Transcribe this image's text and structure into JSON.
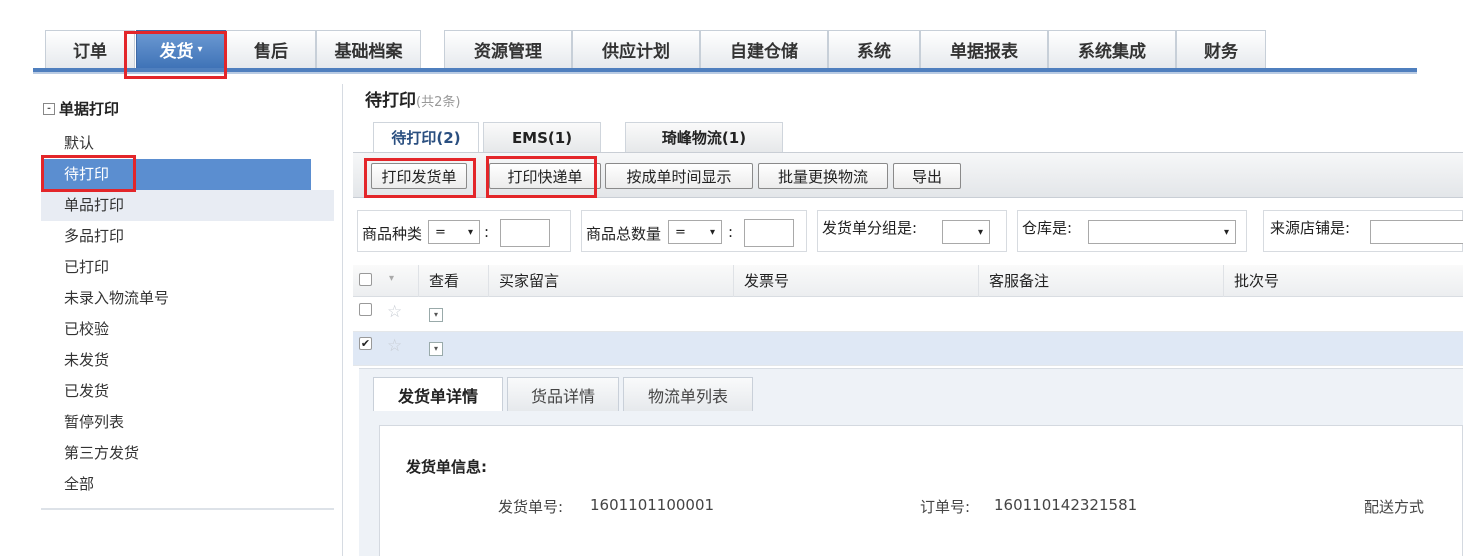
{
  "topnav": {
    "tabs": [
      {
        "label": "订单"
      },
      {
        "label": "发货",
        "caret": "▾"
      },
      {
        "label": "售后"
      },
      {
        "label": "基础档案"
      },
      {
        "label": "资源管理"
      },
      {
        "label": "供应计划"
      },
      {
        "label": "自建仓储"
      },
      {
        "label": "系统"
      },
      {
        "label": "单据报表"
      },
      {
        "label": "系统集成"
      },
      {
        "label": "财务"
      }
    ],
    "active_index": 1,
    "accent_color": "#4f7fbe"
  },
  "sidebar": {
    "section_toggle": "-",
    "section_title": "单据打印",
    "items": [
      {
        "label": "默认"
      },
      {
        "label": "待打印"
      },
      {
        "label": "单品打印"
      },
      {
        "label": "多品打印"
      },
      {
        "label": "已打印"
      },
      {
        "label": "未录入物流单号"
      },
      {
        "label": "已校验"
      },
      {
        "label": "未发货"
      },
      {
        "label": "已发货"
      },
      {
        "label": "暂停列表"
      },
      {
        "label": "第三方发货"
      },
      {
        "label": "全部"
      }
    ],
    "selected_index": 1,
    "selected_color": "#5b8ed0"
  },
  "main": {
    "title": "待打印",
    "count": "(共2条)",
    "subtabs": [
      {
        "label": "待打印(2)"
      },
      {
        "label": "EMS(1)"
      },
      {
        "label": "琦峰物流(1)"
      }
    ],
    "toolbar": {
      "print_ship": "打印发货单",
      "print_express": "打印快递单",
      "by_time": "按成单时间显示",
      "batch_change": "批量更换物流",
      "export": "导出"
    },
    "filters": {
      "product_kind_label": "商品种类",
      "product_kind_op": "=",
      "product_total_label": "商品总数量",
      "product_total_op": "=",
      "colon": ":",
      "group_label": "发货单分组是:",
      "warehouse_label": "仓库是:",
      "store_label": "来源店铺是:"
    },
    "grid": {
      "columns": [
        "查看",
        "买家留言",
        "发票号",
        "客服备注",
        "批次号"
      ],
      "rows": [
        {
          "checked": false
        },
        {
          "checked": true
        }
      ],
      "check_mark": "✔",
      "star_glyph": "☆",
      "dropdown_glyph": "▾"
    },
    "detail": {
      "tabs": [
        {
          "label": "发货单详情"
        },
        {
          "label": "货品详情"
        },
        {
          "label": "物流单列表"
        }
      ],
      "section_title": "发货单信息:",
      "ship_no_label": "发货单号:",
      "ship_no": "1601101100001",
      "order_no_label": "订单号:",
      "order_no": "160110142321581",
      "delivery_label": "配送方式"
    }
  },
  "highlight_color": "#e3262a"
}
